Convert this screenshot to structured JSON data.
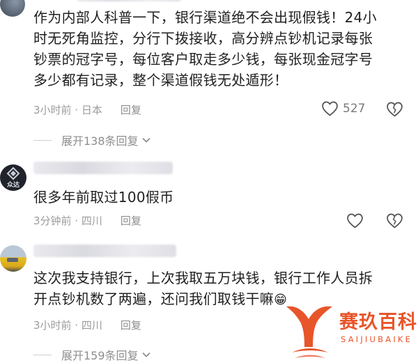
{
  "comments": [
    {
      "text_lines": [
        "作为内部人科普一下，银行渠道绝不会出现假钱！24小",
        "时无死角监控，分行下拨接收，高分辨点钞机记录每张",
        "钞票的冠字号，每位客户取走多少钱，每张现金冠字号",
        "多少都有记录，整个渠道假钱无处遁形！"
      ],
      "time_location": "3小时前 · 日本",
      "reply_label": "回复",
      "like_count": "527",
      "expand_label": "展开138条回复"
    },
    {
      "avatar_text": "众达",
      "text_lines": [
        "很多年前取过100假币"
      ],
      "time_location": "3分钟前 · 四川",
      "reply_label": "回复"
    },
    {
      "text_lines": [
        "这次我支持银行，上次我取五万块钱，银行工作人员拆",
        "开点钞机数了两遍，还问我们取钱干嘛"
      ],
      "emoji": "😁",
      "time_location": "3小时前 · 四川",
      "reply_label": "回复",
      "expand_label": "展开159条回复"
    }
  ],
  "watermark": {
    "title": "赛玖百科",
    "subtitle": "SAIJIUBAIKE",
    "color": "#e8552a"
  },
  "icons": {
    "like": "heart-outline-icon",
    "dislike": "broken-heart-outline-icon",
    "expand": "chevron-down-icon"
  }
}
